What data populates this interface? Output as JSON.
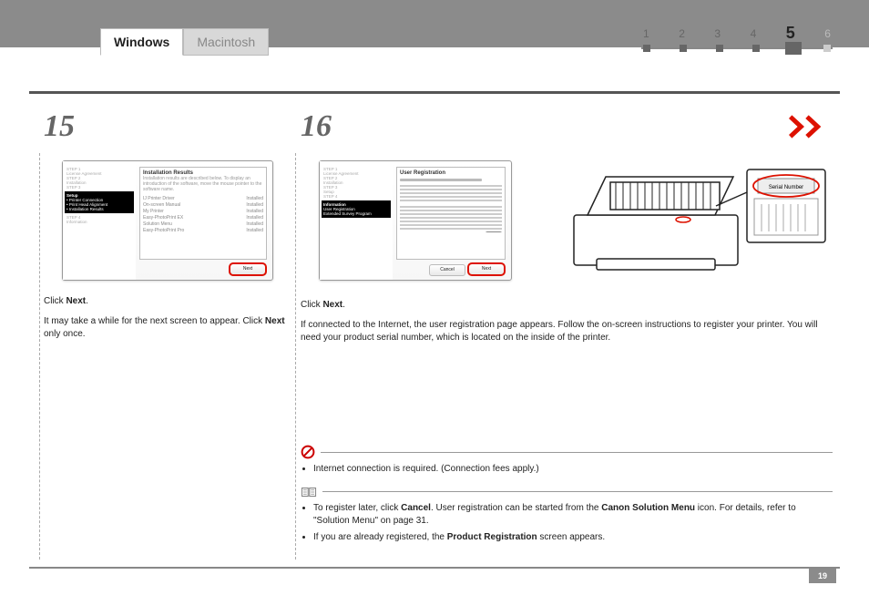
{
  "header": {
    "tabs": [
      "Windows",
      "Macintosh"
    ],
    "activeTab": 0,
    "pager": {
      "steps": [
        "1",
        "2",
        "3",
        "4",
        "5",
        "6"
      ],
      "current": 5
    }
  },
  "nav": {
    "forwardChevrons": true
  },
  "steps": {
    "s15": {
      "number": "15",
      "screenshot": {
        "title": "Installation Results",
        "subtitle": "Installation results are described below. To display an introduction of the software, move the mouse pointer to the software name.",
        "sidebar": [
          "STEP 1",
          "License Agreement",
          "STEP 2",
          "Installation",
          "STEP 3"
        ],
        "sidebarBlack": [
          "Setup",
          "• Printer Connection",
          "• Print Head Alignment",
          "• Installation Results"
        ],
        "sidebarAfter": [
          "STEP 4",
          "Information"
        ],
        "list": [
          {
            "name": "IJ Printer Driver",
            "status": "Installed"
          },
          {
            "name": "On-screen Manual",
            "status": "Installed"
          },
          {
            "name": "My Printer",
            "status": "Installed"
          },
          {
            "name": "Easy-PhotoPrint EX",
            "status": "Installed"
          },
          {
            "name": "Solution Menu",
            "status": "Installed"
          },
          {
            "name": "Easy-PhotoPrint Pro",
            "status": "Installed"
          }
        ],
        "nextBtn": "Next"
      },
      "caption1a": "Click ",
      "caption1b": "Next",
      "caption1c": ".",
      "caption2a": "It may take a while for the next screen to appear. Click ",
      "caption2b": "Next",
      "caption2c": " only once."
    },
    "s16": {
      "number": "16",
      "screenshot": {
        "title": "User Registration",
        "sidebar": [
          "STEP 1",
          "License Agreement",
          "STEP 2",
          "Installation",
          "STEP 3",
          "Setup",
          "STEP 4"
        ],
        "sidebarBlack": [
          "Information",
          "User Registration",
          "Extended Survey Program"
        ],
        "cancelBtn": "Cancel",
        "nextBtn": "Next"
      },
      "printerLabel": "Serial Number",
      "caption1a": "Click ",
      "caption1b": "Next",
      "caption1c": ".",
      "caption2": "If connected to the Internet, the user registration page appears. Follow the on-screen instructions to register your printer. You will need your product serial number, which is located on the inside of the printer.",
      "note1": "Internet connection is required. (Connection fees apply.)",
      "note2_parts": [
        "To register later, click ",
        "Cancel",
        ". User registration can be started from the ",
        "Canon Solution Menu",
        " icon. For details, refer to \"Solution Menu\" on page 31."
      ],
      "note3_parts": [
        "If you are already registered, the ",
        "Product Registration",
        " screen appears."
      ]
    }
  },
  "pageNumber": "19"
}
